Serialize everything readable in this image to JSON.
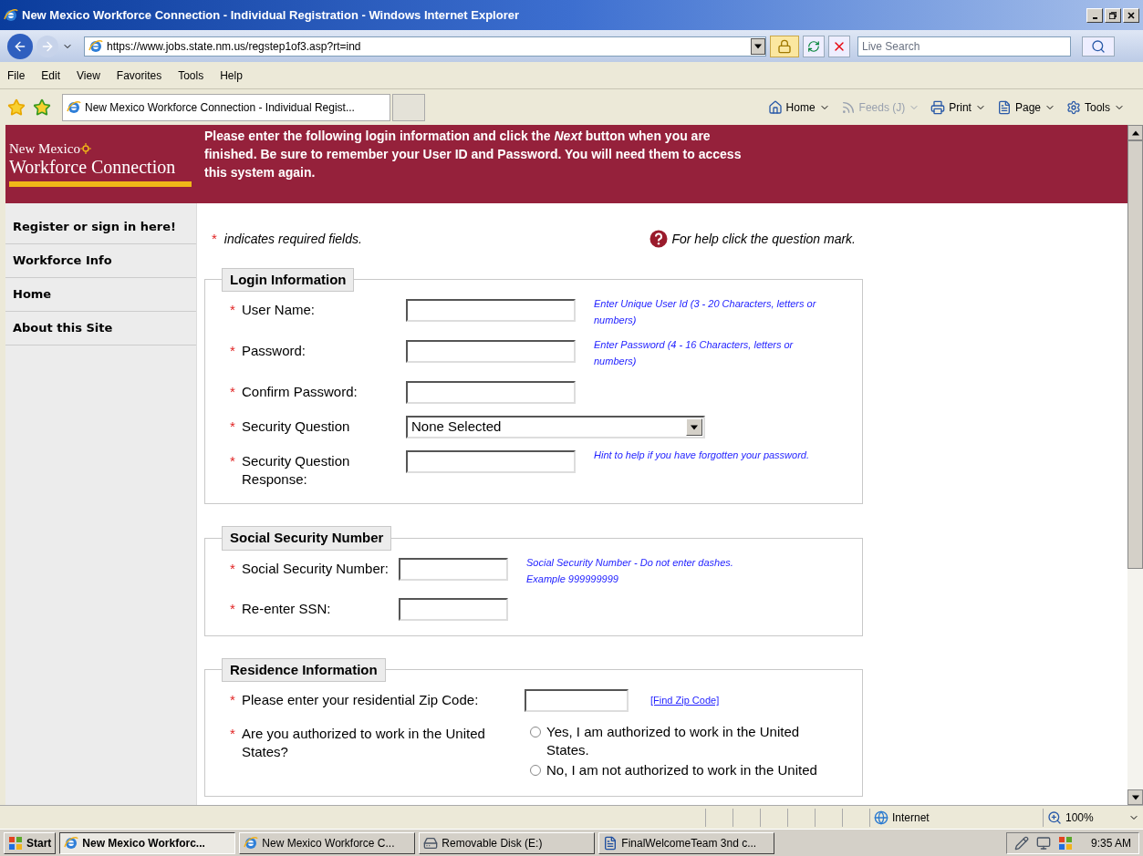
{
  "window": {
    "title": "New Mexico Workforce Connection - Individual Registration - Windows Internet Explorer"
  },
  "address_bar": {
    "url": "https://www.jobs.state.nm.us/regstep1of3.asp?rt=ind",
    "search_placeholder": "Live Search"
  },
  "menu": [
    "File",
    "Edit",
    "View",
    "Favorites",
    "Tools",
    "Help"
  ],
  "tabs": [
    {
      "label": "New Mexico Workforce Connection - Individual Regist...",
      "selected": true
    }
  ],
  "command_bar": [
    {
      "kind": "home",
      "label": "Home",
      "disabled": false
    },
    {
      "kind": "feeds",
      "label": "Feeds (J)",
      "disabled": true
    },
    {
      "kind": "print",
      "label": "Print",
      "disabled": false
    },
    {
      "kind": "page",
      "label": "Page",
      "disabled": false
    },
    {
      "kind": "tools",
      "label": "Tools",
      "disabled": false
    }
  ],
  "page": {
    "logo": {
      "line1": "New Mexico",
      "line2": "Workforce Connection"
    },
    "banner_message": "Please enter the following login information and click the *Next* button when you are finished. Be sure to remember your User ID and Password. You will need them to access this system again.",
    "sidebar": [
      {
        "label": "Register or sign in here!"
      },
      {
        "label": "Workforce Info"
      },
      {
        "label": "Home"
      },
      {
        "label": "About this Site"
      }
    ],
    "required_note": {
      "mark": "*",
      "text": "indicates required fields."
    },
    "help_note": "For help click the question mark.",
    "sections": [
      {
        "title": "Login Information",
        "fields": [
          {
            "kind": "text",
            "mark": "*",
            "label": "User Name:",
            "hint": "Enter Unique User Id (3 - 20 Characters, letters or numbers)"
          },
          {
            "kind": "text",
            "mark": "*",
            "label": "Password:",
            "hint": "Enter Password (4 - 16 Characters, letters or numbers)"
          },
          {
            "kind": "text",
            "mark": "*",
            "label": "Confirm Password:"
          },
          {
            "kind": "select",
            "mark": "*",
            "label": "Security Question",
            "value": "None Selected"
          },
          {
            "kind": "text",
            "mark": "*",
            "label": "Security Question Response:",
            "hint": "Hint to help if you have forgotten your password."
          }
        ]
      },
      {
        "title": "Social Security Number",
        "fields": [
          {
            "kind": "text",
            "mark": "*",
            "label": "Social Security Number:",
            "hint": "Social Security Number - Do not enter dashes. Example 999999999"
          },
          {
            "kind": "text",
            "mark": "*",
            "label": "Re-enter SSN:"
          }
        ]
      },
      {
        "title": "Residence Information",
        "fields": [
          {
            "kind": "text",
            "mark": "*",
            "label": "Please enter your residential Zip Code:",
            "link": "[Find Zip Code]"
          },
          {
            "kind": "radio",
            "mark": "*",
            "label": "Are you authorized to work in the United States?",
            "options": [
              {
                "label": "Yes, I am authorized to work in the United States.",
                "selected": false
              },
              {
                "label": "No, I am not authorized to work in the United",
                "selected": false
              }
            ]
          }
        ]
      }
    ]
  },
  "status_bar": {
    "zone": "Internet",
    "zoom": "100%"
  },
  "taskbar": {
    "start": "Start",
    "tasks": [
      {
        "kind": "ie",
        "label": "New Mexico Workforc...",
        "selected": true
      },
      {
        "kind": "ie",
        "label": "New Mexico Workforce C...",
        "selected": false
      },
      {
        "kind": "drive",
        "label": "Removable Disk (E:)",
        "selected": false
      },
      {
        "kind": "word",
        "label": "FinalWelcomeTeam 3nd c...",
        "selected": false
      }
    ],
    "clock": "9:35 AM"
  }
}
